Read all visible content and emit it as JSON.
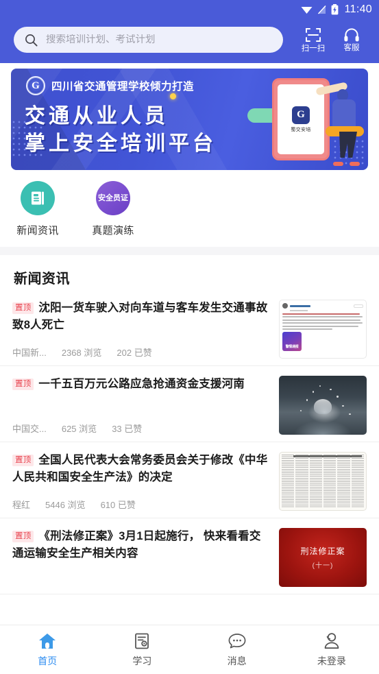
{
  "status_bar": {
    "time": "11:40",
    "icons": [
      "wifi-icon",
      "no-signal-icon",
      "battery-charging-icon"
    ]
  },
  "header": {
    "background_color": "#4a5bd8",
    "search": {
      "placeholder": "搜索培训计划、考试计划",
      "value": "",
      "icon": "search-icon"
    },
    "actions": [
      {
        "icon": "scan-icon",
        "label": "扫一扫"
      },
      {
        "icon": "headset-icon",
        "label": "客服"
      }
    ]
  },
  "banner": {
    "logo_letter": "G",
    "subtitle": "四川省交通管理学校倾力打造",
    "line1": "交通从业人员",
    "line2": "掌上安全培训平台",
    "phone_app_name": "蜀交安培",
    "phone_logo_letter": "G"
  },
  "quick_entries": [
    {
      "label": "新闻资讯",
      "icon": "news-document-icon",
      "color": "#3bbfb2",
      "badge_text": ""
    },
    {
      "label": "真题演练",
      "icon": "safety-certificate-icon",
      "color": "#7b4fd0",
      "badge_text": "安全员证"
    }
  ],
  "news_section": {
    "title": "新闻资讯",
    "pin_label": "置顶",
    "views_suffix": "浏览",
    "likes_suffix": "已赞",
    "items": [
      {
        "pinned": true,
        "headline": "沈阳一货车驶入对向车道与客车发生交通事故 致8人死亡",
        "source": "中国新...",
        "views": "2368",
        "likes": "202",
        "thumb": "weibo-police-report-thumbnail",
        "thumb_caption": "警情通报"
      },
      {
        "pinned": true,
        "headline": "一千五百万元公路应急抢通资金支援河南",
        "source": "中国交...",
        "views": "625",
        "likes": "33",
        "thumb": "rain-splash-photo-thumbnail",
        "thumb_caption": ""
      },
      {
        "pinned": true,
        "headline": "全国人民代表大会常务委员会关于修改《中华人民共和国安全生产法》的决定",
        "source": "程红",
        "views": "5446",
        "likes": "610",
        "thumb": "newspaper-scan-thumbnail",
        "thumb_caption": ""
      },
      {
        "pinned": true,
        "headline": "《刑法修正案》3月1日起施行， 快来看看交通运输安全生产相关内容",
        "source": "",
        "views": "",
        "likes": "",
        "thumb": "red-law-card-thumbnail",
        "thumb_caption": "刑法修正案",
        "thumb_caption2": "(十一)"
      }
    ]
  },
  "tab_bar": {
    "active_color": "#2d8cf0",
    "items": [
      {
        "label": "首页",
        "icon": "home-icon",
        "active": true
      },
      {
        "label": "学习",
        "icon": "study-document-icon",
        "active": false
      },
      {
        "label": "消息",
        "icon": "message-bubble-icon",
        "active": false
      },
      {
        "label": "未登录",
        "icon": "user-icon",
        "active": false
      }
    ]
  }
}
